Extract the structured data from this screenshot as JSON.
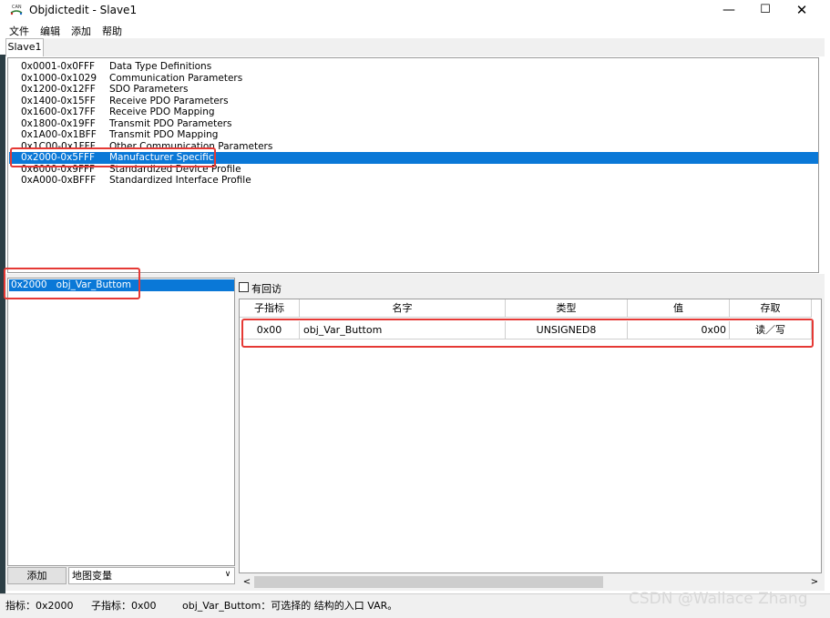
{
  "window": {
    "title": "Objdictedit - Slave1",
    "icon_text": "CAN"
  },
  "menu": [
    "文件",
    "编辑",
    "添加",
    "帮助"
  ],
  "tabs": [
    "Slave1"
  ],
  "ranges": [
    {
      "range": "0x0001-0x0FFF",
      "name": "Data Type Definitions"
    },
    {
      "range": "0x1000-0x1029",
      "name": "Communication Parameters"
    },
    {
      "range": "0x1200-0x12FF",
      "name": "SDO Parameters"
    },
    {
      "range": "0x1400-0x15FF",
      "name": "Receive PDO Parameters"
    },
    {
      "range": "0x1600-0x17FF",
      "name": "Receive PDO Mapping"
    },
    {
      "range": "0x1800-0x19FF",
      "name": "Transmit PDO Parameters"
    },
    {
      "range": "0x1A00-0x1BFF",
      "name": "Transmit PDO Mapping"
    },
    {
      "range": "0x1C00-0x1FFF",
      "name": "Other Communication Parameters"
    },
    {
      "range": "0x2000-0x5FFF",
      "name": "Manufacturer Specific"
    },
    {
      "range": "0x6000-0x9FFF",
      "name": "Standardized Device Profile"
    },
    {
      "range": "0xA000-0xBFFF",
      "name": "Standardized Interface Profile"
    }
  ],
  "selected_range_index": 8,
  "index_list": {
    "items": [
      {
        "index": "0x2000",
        "name": "obj_Var_Buttom"
      }
    ]
  },
  "controls": {
    "add_label": "添加",
    "map_select_value": "地图变量",
    "checkbox_label": "有回访",
    "checkbox_checked": false
  },
  "grid": {
    "headers": [
      "子指标",
      "名字",
      "类型",
      "值",
      "存取"
    ],
    "rows": [
      [
        "0x00",
        "obj_Var_Buttom",
        "UNSIGNED8",
        "0x00",
        "读／写"
      ]
    ]
  },
  "status": {
    "index": "指标：0x2000",
    "subindex": "子指标：0x00",
    "description": "obj_Var_Buttom：可选择的 结构的入口 VAR。"
  },
  "watermark": "CSDN @Wallace Zhang",
  "colors": {
    "selection": "#0a78d7",
    "annotation": "#e53935"
  }
}
